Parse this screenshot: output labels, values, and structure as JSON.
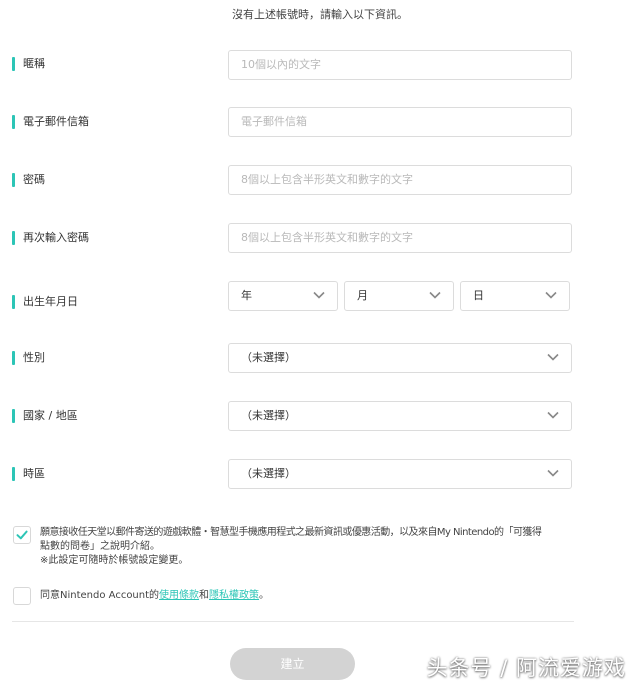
{
  "intro_text": "沒有上述帳號時，請輸入以下資訊。",
  "colors": {
    "accent": "#2cc5b6",
    "button_disabled": "#d3d3d3"
  },
  "fields": {
    "nickname": {
      "label": "暱稱",
      "placeholder": "10個以內的文字"
    },
    "email": {
      "label": "電子郵件信箱",
      "placeholder": "電子郵件信箱"
    },
    "password": {
      "label": "密碼",
      "placeholder": "8個以上包含半形英文和數字的文字"
    },
    "password_confirm": {
      "label": "再次輸入密碼",
      "placeholder": "8個以上包含半形英文和數字的文字"
    }
  },
  "birthday": {
    "label": "出生年月日",
    "year": "年",
    "month": "月",
    "day": "日"
  },
  "gender": {
    "label": "性別",
    "value": "（未選擇）"
  },
  "country": {
    "label": "國家 / 地區",
    "value": "（未選擇）"
  },
  "timezone": {
    "label": "時區",
    "value": "（未選擇）"
  },
  "newsletter": {
    "checked": true,
    "line1": "願意接收任天堂以郵件寄送的遊戲軟體・智慧型手機應用程式之最新資訊或優惠活動，以及來自My Nintendo的「可獲得",
    "line2": "點數的問卷」之說明介紹。",
    "line3": "※此設定可隨時於帳號設定變更。"
  },
  "agreement": {
    "checked": false,
    "prefix": "同意Nintendo Account的",
    "terms_link": "使用條款",
    "and": "和",
    "privacy_link": "隱私權政策",
    "suffix": "。"
  },
  "submit_label": "建立",
  "watermark": "头条号 / 阿流爱游戏",
  "icons": {
    "dropdown": "chevron-down-icon",
    "check": "check-icon"
  }
}
